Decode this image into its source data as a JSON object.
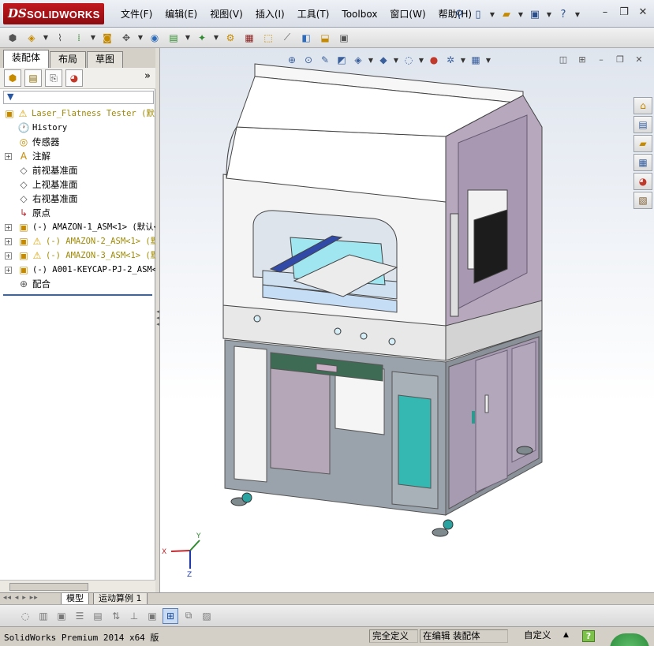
{
  "app": {
    "logo_ds": "DS",
    "logo_text": "SOLIDWORKS"
  },
  "menu": [
    "文件(F)",
    "编辑(E)",
    "视图(V)",
    "插入(I)",
    "工具(T)",
    "Toolbox",
    "窗口(W)",
    "帮助(H)"
  ],
  "title_tools": [
    "pin-icon",
    "new-document-icon",
    "open-folder-icon",
    "save-icon",
    "help-question-icon"
  ],
  "window_controls": [
    "minimize-icon",
    "restore-icon",
    "close-icon"
  ],
  "command_icons": [
    "assembly-icon",
    "insert-component-icon",
    "mate-icon",
    "linear-pattern-icon",
    "smart-fasteners-icon",
    "move-component-icon",
    "show-hidden-icon",
    "assembly-features-icon",
    "reference-geometry-icon",
    "new-motion-study-icon",
    "bill-of-materials-icon",
    "exploded-view-icon",
    "explode-line-icon",
    "interference-icon",
    "clearance-icon",
    "hole-alignment-icon",
    "measure-icon",
    "mass-properties-icon"
  ],
  "fm_tabs": [
    "装配体",
    "布局",
    "草图"
  ],
  "fm_icons": [
    "featuremanager-icon",
    "propertymanager-icon",
    "configurationmanager-icon",
    "appearance-icon"
  ],
  "fm_expand": "»",
  "tree": [
    {
      "label": "Laser_Flatness Tester  (默",
      "icon": "⚠",
      "pm": "",
      "indent": 0,
      "mono": true,
      "warn": true
    },
    {
      "label": "History",
      "icon": "🕐",
      "pm": "",
      "indent": 1,
      "mono": true,
      "warn": false
    },
    {
      "label": "传感器",
      "icon": "◎",
      "pm": "",
      "indent": 1,
      "mono": false,
      "warn": false
    },
    {
      "label": "注解",
      "icon": "A",
      "pm": "+",
      "indent": 1,
      "mono": false,
      "warn": false
    },
    {
      "label": "前视基准面",
      "icon": "◇",
      "pm": "",
      "indent": 1,
      "mono": false,
      "warn": false
    },
    {
      "label": "上视基准面",
      "icon": "◇",
      "pm": "",
      "indent": 1,
      "mono": false,
      "warn": false
    },
    {
      "label": "右视基准面",
      "icon": "◇",
      "pm": "",
      "indent": 1,
      "mono": false,
      "warn": false
    },
    {
      "label": "原点",
      "icon": "↳",
      "pm": "",
      "indent": 1,
      "mono": false,
      "warn": false
    },
    {
      "label": "(-) AMAZON-1_ASM<1> (默认<",
      "icon": "▣",
      "pm": "+",
      "indent": 1,
      "mono": true,
      "warn": false
    },
    {
      "label": "(-) AMAZON-2_ASM<1> (默",
      "icon": "⚠",
      "pm": "+",
      "indent": 1,
      "mono": true,
      "warn": true
    },
    {
      "label": "(-) AMAZON-3_ASM<1> (默",
      "icon": "⚠",
      "pm": "+",
      "indent": 1,
      "mono": true,
      "warn": true
    },
    {
      "label": "(-) A001-KEYCAP-PJ-2_ASM<",
      "icon": "▣",
      "pm": "+",
      "indent": 1,
      "mono": true,
      "warn": false
    },
    {
      "label": "配合",
      "icon": "⊕",
      "pm": "",
      "indent": 1,
      "mono": false,
      "warn": false
    }
  ],
  "headsup_icons": [
    "zoom-to-fit-icon",
    "zoom-to-area-icon",
    "previous-view-icon",
    "section-view-icon",
    "view-orientation-icon",
    "display-style-icon",
    "hide-show-items-icon",
    "edit-appearance-icon",
    "apply-scene-icon",
    "view-settings-icon"
  ],
  "taskpane_icons": [
    "solidworks-resources-icon",
    "design-library-icon",
    "file-explorer-icon",
    "view-palette-icon",
    "appearances-scenes-icon",
    "custom-properties-icon"
  ],
  "triad": {
    "x": "X",
    "y": "Y",
    "z": "Z"
  },
  "bottom_tabs": [
    "模型",
    "运动算例 1"
  ],
  "view_icons": [
    "wireframe-icon",
    "hidden-lines-visible-icon",
    "hidden-lines-removed-icon",
    "shaded-with-edges-icon",
    "shaded-icon",
    "section-icon",
    "dimensions-icon",
    "isometric-icon",
    "shaded-cube-icon",
    "tangent-edges-icon",
    "perspective-icon"
  ],
  "status": {
    "product": "SolidWorks Premium 2014 x64 版",
    "constraint": "完全定义",
    "editing": "在编辑 装配体",
    "units": "自定义",
    "help": "?"
  },
  "colors": {
    "accent": "#c21a1f",
    "panel_bg": "#d4d0c8",
    "viewport_top": "#dfe5ee",
    "warning": "#a08a00"
  }
}
